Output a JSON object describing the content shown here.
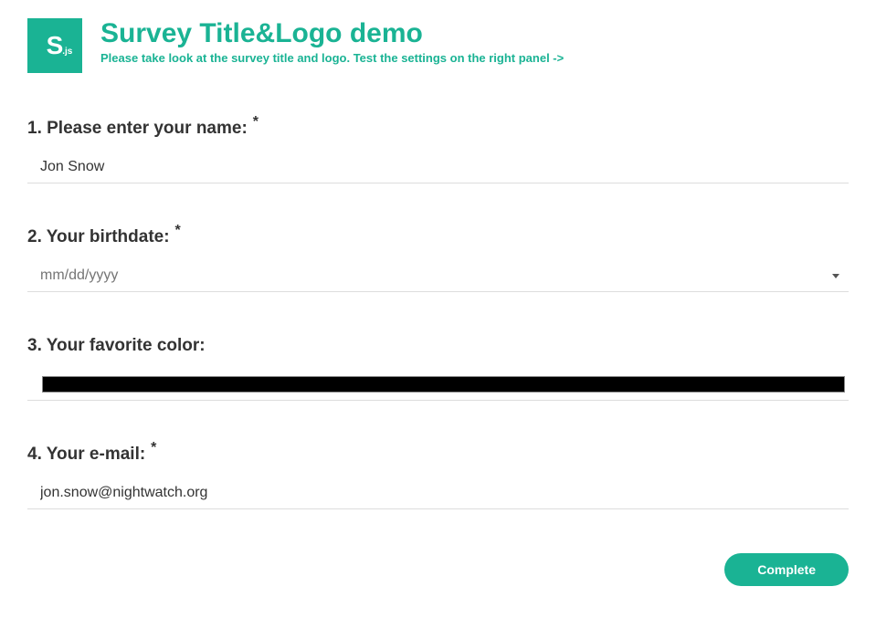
{
  "logo": {
    "main": "S",
    "sub": ".js"
  },
  "header": {
    "title": "Survey Title&Logo demo",
    "description": "Please take look at the survey title and logo. Test the settings on the right panel ->"
  },
  "questions": {
    "q1": {
      "label": "1. Please enter your name:",
      "required_marker": "*",
      "value": "Jon Snow"
    },
    "q2": {
      "label": "2. Your birthdate:",
      "required_marker": "*",
      "placeholder": "mm/dd/yyyy"
    },
    "q3": {
      "label": "3. Your favorite color:",
      "value": "#000000"
    },
    "q4": {
      "label": "4. Your e-mail:",
      "required_marker": "*",
      "value": "jon.snow@nightwatch.org"
    }
  },
  "footer": {
    "complete_label": "Complete"
  },
  "colors": {
    "primary": "#1ab394"
  }
}
